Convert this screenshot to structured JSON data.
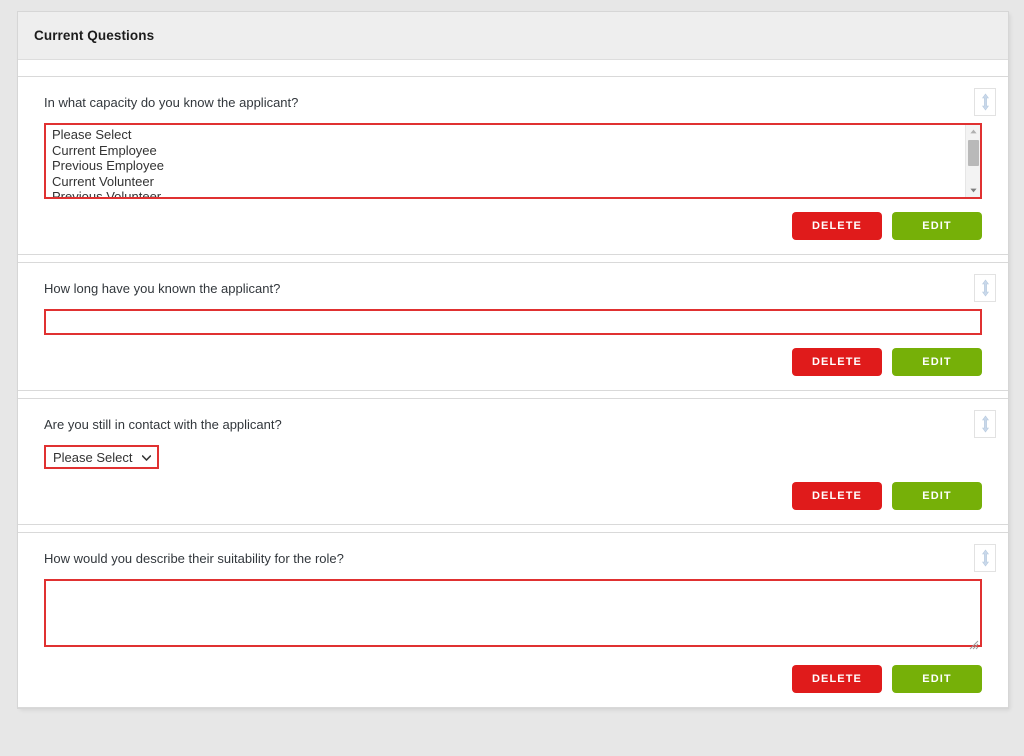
{
  "page": {
    "background_color": "#e7e7e7"
  },
  "panel": {
    "title": "Current Questions",
    "header_bg": "#eeeeee"
  },
  "colors": {
    "field_border_red": "#e03131",
    "delete_button": "#e01b1b",
    "edit_button": "#76b008",
    "label_text": "#32373c"
  },
  "buttons": {
    "delete_label": "DELETE",
    "edit_label": "EDIT"
  },
  "icons": {
    "drag_handle": "arrows-vertical-icon",
    "chevron_down": "chevron-down-icon",
    "resize_grip": "resize-handle-icon",
    "scroll_up": "scroll-up-arrow-icon",
    "scroll_down": "scroll-down-arrow-icon"
  },
  "questions": [
    {
      "label": "In what capacity do you know the applicant?",
      "field_type": "listbox",
      "options": [
        "Please Select",
        "Current Employee",
        "Previous Employee",
        "Current Volunteer",
        "Previous Volunteer"
      ],
      "value": "",
      "placeholder": ""
    },
    {
      "label": "How long have you known the applicant?",
      "field_type": "text",
      "options": [],
      "value": "",
      "placeholder": ""
    },
    {
      "label": "Are you still in contact with the applicant?",
      "field_type": "select",
      "options": [
        "Please Select"
      ],
      "value": "Please Select",
      "placeholder": ""
    },
    {
      "label": "How would you describe their suitability for the role?",
      "field_type": "textarea",
      "options": [],
      "value": "",
      "placeholder": ""
    }
  ]
}
